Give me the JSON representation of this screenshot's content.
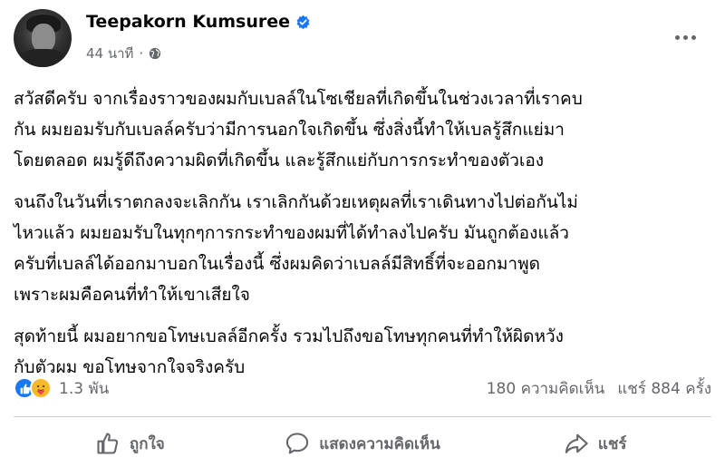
{
  "post": {
    "author": "Teepakorn Kumsuree",
    "time": "44 นาที",
    "separator": "·",
    "paragraphs": [
      [
        "สวัสดีครับ จากเรื่องราวของผมกับเบลล์ในโซเชียลที่เกิดขึ้นในช่วงเวลาที่เราคบ",
        "กัน ผมยอมรับกับเบลล์ครับว่ามีการนอกใจเกิดขึ้น ซึ่งสิ่งนี้ทำให้เบลรู้สึกแย่มา",
        "โดยตลอด ผมรู้ดีถึงความผิดที่เกิดขึ้น และรู้สึกแย่กับการกระทำของตัวเอง"
      ],
      [
        "จนถึงในวันที่เราตกลงจะเลิกกัน เราเลิกกันด้วยเหตุผลที่เราเดินทางไปต่อกันไม่",
        "ไหวแล้ว ผมยอมรับในทุกๆการกระทำของผมที่ได้ทำลงไปครับ มันถูกต้องแล้ว",
        "ครับที่เบลล์ได้ออกมาบอกในเรื่องนี้ ซึ่งผมคิดว่าเบลล์มีสิทธิ์ที่จะออกมาพูด",
        "เพราะผมคือคนที่ทำให้เขาเสียใจ"
      ],
      [
        "สุดท้ายนี้ ผมอยากขอโทษเบลล์อีกครั้ง รวมไปถึงขอโทษทุกคนที่ทำให้ผิดหวัง",
        "กับตัวผม ขอโทษจากใจจริงครับ"
      ]
    ]
  },
  "stats": {
    "reactions": "1.3 พัน",
    "comments": "180 ความคิดเห็น",
    "shares": "แชร์ 884 ครั้ง"
  },
  "actions": {
    "like": "ถูกใจ",
    "comment": "แสดงความคิดเห็น",
    "share": "แชร์"
  },
  "colors": {
    "brand": "#1877f2",
    "secondary_text": "#65676b",
    "care": "#f7b928"
  },
  "icons": {
    "verified": "verified-badge-icon",
    "audience": "globe-icon",
    "more": "more-options-icon",
    "like_reaction": "thumbs-up-reaction-icon",
    "care_reaction": "care-reaction-icon",
    "like_action": "thumbs-up-icon",
    "comment_action": "comment-bubble-icon",
    "share_action": "share-arrow-icon"
  }
}
